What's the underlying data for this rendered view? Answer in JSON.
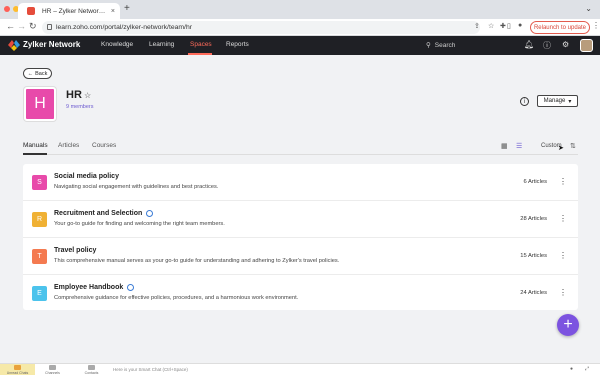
{
  "browser": {
    "tab_title": "HR – Zylker Network – Zoho L...",
    "tab_close": "×",
    "new_tab": "+",
    "url": "learn.zoho.com/portal/zylker-network/team/hr",
    "relaunch_label": "Relaunch to update",
    "icons": [
      "back-icon",
      "forward-icon",
      "reload-icon",
      "lock-icon",
      "share-icon",
      "bookmark-icon",
      "extensions-icon",
      "sidebar-icon",
      "profile-icon",
      "menu-icon"
    ]
  },
  "header": {
    "brand": "Zylker Network",
    "nav": [
      "Knowledge",
      "Learning",
      "Spaces",
      "Reports"
    ],
    "active_nav": "Spaces",
    "search_placeholder": "Search",
    "accent": "#ff6b5a"
  },
  "space": {
    "back_label": "Back",
    "initial": "H",
    "name": "HR",
    "members": "9 members",
    "manage_label": "Manage",
    "icon_color": "#e84aaa"
  },
  "tabs": {
    "items": [
      "Manuals",
      "Articles",
      "Courses"
    ],
    "active": "Manuals",
    "sort_label": "Custom"
  },
  "manuals": [
    {
      "initial": "S",
      "color": "#e84aaa",
      "title": "Social media policy",
      "globe": false,
      "desc": "Navigating social engagement with guidelines and best practices.",
      "count": "6 Articles"
    },
    {
      "initial": "R",
      "color": "#f0b134",
      "title": "Recruitment and Selection",
      "globe": true,
      "desc": "Your go-to guide for finding and welcoming the right team members.",
      "count": "28 Articles"
    },
    {
      "initial": "T",
      "color": "#f47a50",
      "title": "Travel policy",
      "globe": false,
      "desc": "This comprehensive manual serves as your go-to guide for understanding and adhering to Zylker's travel policies.",
      "count": "15 Articles"
    },
    {
      "initial": "E",
      "color": "#4cc3ec",
      "title": "Employee Handbook",
      "globe": true,
      "desc": "Comprehensive guidance for effective policies, procedures, and a harmonious work environment.",
      "count": "24 Articles"
    }
  ],
  "fab_label": "+",
  "bottombar": {
    "items": [
      "Unread Chats",
      "Channels",
      "Contacts"
    ],
    "smartchat_placeholder": "Here is your Smart Chat (Ctrl+Space)"
  }
}
